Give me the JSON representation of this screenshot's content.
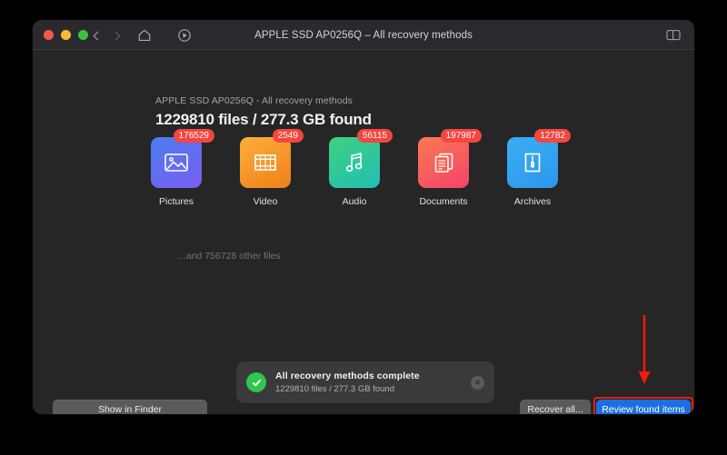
{
  "window": {
    "title": "APPLE SSD AP0256Q – All recovery methods",
    "traffic_lights": [
      "close-red",
      "minimize-yellow",
      "zoom-green"
    ],
    "toolbar": {
      "back_icon": "chevron-left-icon",
      "forward_icon": "chevron-right-icon",
      "home_icon": "home-icon",
      "scan_icon": "disk-scan-icon",
      "panel_toggle_icon": "sidebar-toggle-icon"
    }
  },
  "header": {
    "subtitle": "APPLE SSD AP0256Q - All recovery methods",
    "title": "1229810 files / 277.3 GB found"
  },
  "categories": [
    {
      "label": "Pictures",
      "count": "176529",
      "icon": "image-icon",
      "color_start": "#4a7df0",
      "color_end": "#7a5df0"
    },
    {
      "label": "Video",
      "count": "2549",
      "icon": "film-strip-icon",
      "color_start": "#f7a game",
      "color_end": "#f07f18"
    },
    {
      "label": "Audio",
      "count": "56115",
      "icon": "music-note-icon",
      "color_start": "#3fd07f",
      "color_end": "#26bfae"
    },
    {
      "label": "Documents",
      "count": "197987",
      "icon": "documents-icon",
      "color_start": "#f9714f",
      "color_end": "#f5426b"
    },
    {
      "label": "Archives",
      "count": "12782",
      "icon": "archive-zip-icon",
      "color_start": "#35a8f0",
      "color_end": "#2f9ef0"
    }
  ],
  "other_files": "...and 756728 other files",
  "notification": {
    "icon": "success-check-icon",
    "title": "All recovery methods complete",
    "subtitle": "1229810 files / 277.3 GB found",
    "close_icon": "close-icon"
  },
  "footer": {
    "show_in_finder": "Show in Finder",
    "recover_all": "Recover all...",
    "review_found_items": "Review found items"
  },
  "annotation": {
    "arrow_color": "#f01b0e",
    "highlight_color": "#f01b0e",
    "target": "review-found-items-button"
  },
  "colors": {
    "window_bg": "#262626",
    "titlebar_bg": "#2a2a2e",
    "badge_red": "#f4463e",
    "accent_blue": "#1b6fe0",
    "success_green": "#2fc84b"
  }
}
